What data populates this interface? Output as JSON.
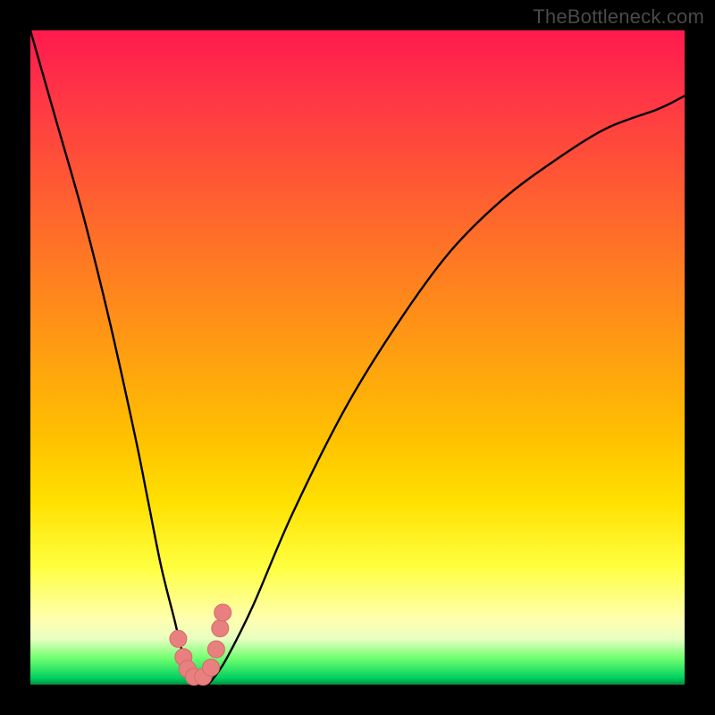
{
  "watermark": "TheBottleneck.com",
  "colors": {
    "frame": "#000000",
    "curve_stroke": "#000000",
    "marker_fill": "#e98080",
    "marker_stroke": "#d86868"
  },
  "chart_data": {
    "type": "line",
    "title": "",
    "xlabel": "",
    "ylabel": "",
    "xlim": [
      0,
      100
    ],
    "ylim": [
      0,
      100
    ],
    "note": "V-shaped bottleneck curve over red-to-green vertical gradient. Values are percentage height (0 = bottom/green, 100 = top/red) estimated from pixels.",
    "series": [
      {
        "name": "bottleneck-curve",
        "x": [
          0,
          4,
          8,
          12,
          16,
          18,
          20,
          22,
          23.5,
          25,
          26,
          27,
          28,
          30,
          34,
          40,
          48,
          56,
          64,
          72,
          80,
          88,
          96,
          100
        ],
        "y": [
          100,
          86,
          72,
          56,
          38,
          28,
          18,
          10,
          4,
          1,
          0,
          0,
          1,
          4,
          12,
          26,
          42,
          55,
          66,
          74,
          80,
          85,
          88,
          90
        ]
      }
    ],
    "markers": {
      "name": "highlight-dots",
      "x": [
        22.6,
        23.4,
        24.0,
        25.0,
        26.4,
        27.6,
        28.4,
        29.0,
        29.4
      ],
      "y": [
        7.0,
        4.2,
        2.4,
        1.2,
        1.2,
        2.6,
        5.4,
        8.6,
        11.0
      ]
    }
  }
}
